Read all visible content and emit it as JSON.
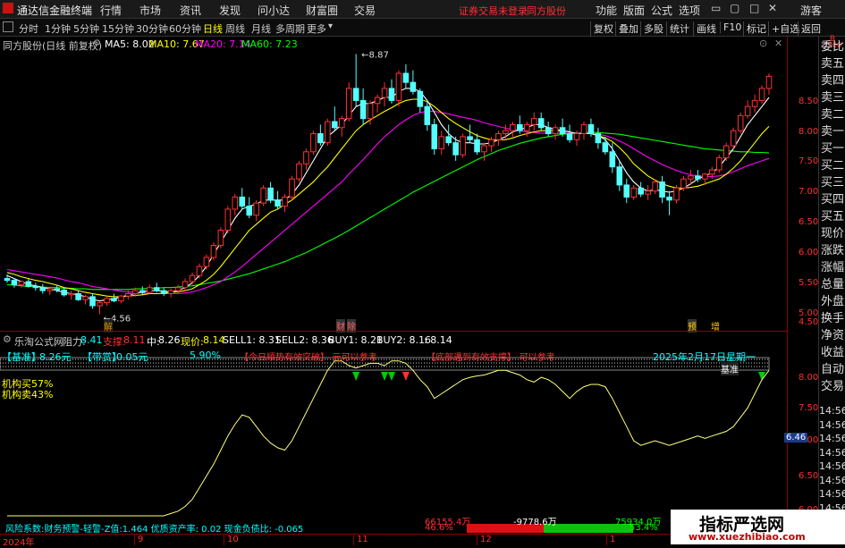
{
  "app_title": "通达信金融终端",
  "menus": [
    "行情",
    "市场",
    "资讯",
    "发现",
    "问小达",
    "财富圈",
    "交易"
  ],
  "login_status": "证券交易未登录",
  "broker": "同方股份",
  "top_right": [
    "功能",
    "版面",
    "公式",
    "选项"
  ],
  "guest": "游客",
  "timeframes": [
    "分时",
    "1分钟",
    "5分钟",
    "15分钟",
    "30分钟",
    "60分钟",
    "日线",
    "周线",
    "月线",
    "多周期",
    "更多"
  ],
  "active_timeframe": "日线",
  "toolbar_buttons": [
    "复权",
    "叠加",
    "多股",
    "统计",
    "画线",
    "F10",
    "标记",
    "+自选",
    "返回"
  ],
  "stock_info": "同方股份(日线 前复权)",
  "ma": {
    "ma5_label": "MA5: 8.02",
    "ma10_label": "MA10: 7.67",
    "ma20_label": "MA20: 7.14",
    "ma60_label": "MA60: 7.23",
    "ma5_color": "#ffffff",
    "ma10_color": "#ffff00",
    "ma20_color": "#ff00ff",
    "ma60_color": "#00ff00"
  },
  "price_axis": [
    "8.50",
    "8.00",
    "7.50",
    "7.00",
    "6.50",
    "6.00",
    "5.50",
    "5.00",
    "4.50"
  ],
  "price_annotations": {
    "high": "8.87",
    "low": "4.56"
  },
  "event_markers": [
    "解",
    "财",
    "除",
    "预",
    "增"
  ],
  "indicator": {
    "name": "乐淘公式网",
    "resistance_label": "阻力:",
    "resistance": "8.41",
    "support_label": "支撑:",
    "support": "8.11",
    "mid_label": "中:",
    "mid": "8.26",
    "price_label": "现价:",
    "price": "8.14",
    "sell1": "SELL1: 8.31",
    "sell2": "SELL2: 8.36",
    "buy1": "BUY1: 8.21",
    "buy2": "BUY2: 8.16",
    "last": ": 8.14",
    "baseline_tag": "【基准】",
    "baseline": "8.26元",
    "bear_tag": "【带赏】",
    "bear": "0.05元",
    "pct": "5.90%",
    "note1": "【今日顺势有效突破】-元可以参考",
    "note2": "【底部遇到有效支撑】-可以参考",
    "date": "2025年2月17日星期一",
    "baseline_marker": "基准",
    "inst_buy": "机构买57%",
    "inst_sell": "机构卖43%",
    "risk_text": "风险系数:财务预警-轻警-Z值:1.464 优质资产率: 0.02 现金负债比: -0.065",
    "sub_axis": [
      "8.00",
      "7.50",
      "7.00",
      "6.50",
      "6.00"
    ],
    "current_tag": "6.46"
  },
  "flow": {
    "left_amount": "66155.4万",
    "left_pct": "46.6%",
    "mid_amount": "-9778.6万",
    "right_amount": "75934.0万",
    "right_pct": "53.4%"
  },
  "date_axis": [
    "2024年",
    "9",
    "10",
    "11",
    "12",
    "1"
  ],
  "right_side_labels": [
    "委比",
    "卖五",
    "卖四",
    "卖三",
    "卖二",
    "卖一",
    "买一",
    "买二",
    "买三",
    "买四",
    "买五",
    "现价",
    "涨跌",
    "涨幅",
    "总量",
    "外盘",
    "换手",
    "净资",
    "收益",
    "自动",
    "交易"
  ],
  "time_labels": [
    "14:56",
    "14:56",
    "14:56",
    "14:56",
    "14:56",
    "14:56",
    "14:56",
    "14:56",
    "14:56",
    "14:56"
  ],
  "watermark": {
    "title": "指标严选网",
    "url": "www.xuezhibiao.com"
  },
  "chart_data": {
    "type": "candlestick",
    "title": "同方股份(日线 前复权)",
    "ylim": [
      4.3,
      8.95
    ],
    "candles": [
      [
        5.15,
        5.22,
        5.08,
        5.12
      ],
      [
        5.12,
        5.16,
        5.0,
        5.05
      ],
      [
        5.05,
        5.12,
        5.0,
        5.1
      ],
      [
        5.1,
        5.15,
        5.0,
        5.02
      ],
      [
        5.02,
        5.08,
        4.95,
        5.0
      ],
      [
        5.0,
        5.06,
        4.9,
        4.95
      ],
      [
        4.95,
        5.02,
        4.88,
        4.98
      ],
      [
        4.98,
        5.05,
        4.92,
        4.96
      ],
      [
        4.96,
        5.0,
        4.85,
        4.88
      ],
      [
        4.88,
        4.95,
        4.8,
        4.9
      ],
      [
        4.9,
        4.96,
        4.78,
        4.8
      ],
      [
        4.8,
        4.88,
        4.72,
        4.85
      ],
      [
        4.85,
        4.9,
        4.65,
        4.7
      ],
      [
        4.7,
        4.78,
        4.56,
        4.75
      ],
      [
        4.75,
        4.86,
        4.7,
        4.82
      ],
      [
        4.82,
        4.9,
        4.76,
        4.78
      ],
      [
        4.78,
        4.88,
        4.74,
        4.86
      ],
      [
        4.86,
        4.95,
        4.8,
        4.9
      ],
      [
        4.9,
        5.0,
        4.85,
        4.95
      ],
      [
        4.95,
        5.02,
        4.88,
        4.92
      ],
      [
        4.92,
        5.05,
        4.9,
        5.0
      ],
      [
        5.0,
        5.08,
        4.92,
        4.95
      ],
      [
        4.95,
        5.0,
        4.86,
        4.9
      ],
      [
        4.9,
        4.98,
        4.84,
        4.95
      ],
      [
        4.95,
        5.05,
        4.9,
        5.0
      ],
      [
        5.0,
        5.15,
        4.95,
        5.1
      ],
      [
        5.1,
        5.25,
        5.05,
        5.2
      ],
      [
        5.2,
        5.4,
        5.15,
        5.35
      ],
      [
        5.35,
        5.55,
        5.3,
        5.5
      ],
      [
        5.5,
        5.75,
        5.45,
        5.7
      ],
      [
        5.7,
        6.0,
        5.65,
        5.95
      ],
      [
        5.95,
        6.35,
        5.9,
        6.3
      ],
      [
        6.3,
        6.55,
        6.2,
        6.5
      ],
      [
        6.5,
        6.65,
        6.3,
        6.35
      ],
      [
        6.35,
        6.5,
        6.15,
        6.2
      ],
      [
        6.2,
        6.45,
        6.1,
        6.4
      ],
      [
        6.4,
        6.7,
        6.35,
        6.65
      ],
      [
        6.65,
        6.75,
        6.4,
        6.45
      ],
      [
        6.45,
        6.6,
        6.3,
        6.35
      ],
      [
        6.35,
        6.55,
        6.25,
        6.5
      ],
      [
        6.5,
        6.85,
        6.45,
        6.8
      ],
      [
        6.8,
        7.1,
        6.75,
        7.05
      ],
      [
        7.05,
        7.3,
        6.95,
        7.25
      ],
      [
        7.25,
        7.6,
        7.2,
        7.55
      ],
      [
        7.55,
        7.7,
        7.35,
        7.4
      ],
      [
        7.4,
        7.8,
        7.35,
        7.75
      ],
      [
        7.75,
        8.0,
        7.6,
        7.65
      ],
      [
        7.65,
        7.85,
        7.5,
        7.8
      ],
      [
        7.8,
        8.4,
        7.75,
        8.3
      ],
      [
        8.3,
        8.87,
        8.0,
        8.1
      ],
      [
        8.1,
        8.3,
        7.7,
        7.8
      ],
      [
        7.8,
        8.1,
        7.7,
        8.05
      ],
      [
        8.05,
        8.2,
        7.9,
        8.15
      ],
      [
        8.15,
        8.4,
        8.0,
        8.3
      ],
      [
        8.3,
        8.45,
        8.05,
        8.1
      ],
      [
        8.1,
        8.6,
        8.0,
        8.55
      ],
      [
        8.55,
        8.7,
        8.3,
        8.4
      ],
      [
        8.4,
        8.6,
        8.2,
        8.25
      ],
      [
        8.25,
        8.3,
        7.9,
        8.0
      ],
      [
        8.0,
        8.1,
        7.6,
        7.7
      ],
      [
        7.7,
        7.8,
        7.2,
        7.3
      ],
      [
        7.3,
        7.6,
        7.2,
        7.5
      ],
      [
        7.5,
        7.7,
        7.35,
        7.4
      ],
      [
        7.4,
        7.5,
        7.1,
        7.2
      ],
      [
        7.2,
        7.55,
        7.15,
        7.5
      ],
      [
        7.5,
        7.7,
        7.4,
        7.45
      ],
      [
        7.45,
        7.55,
        7.2,
        7.25
      ],
      [
        7.25,
        7.4,
        7.1,
        7.35
      ],
      [
        7.35,
        7.5,
        7.25,
        7.45
      ],
      [
        7.45,
        7.6,
        7.35,
        7.55
      ],
      [
        7.55,
        7.7,
        7.45,
        7.6
      ],
      [
        7.6,
        7.75,
        7.5,
        7.7
      ],
      [
        7.7,
        7.85,
        7.55,
        7.6
      ],
      [
        7.6,
        7.75,
        7.5,
        7.7
      ],
      [
        7.7,
        7.9,
        7.6,
        7.8
      ],
      [
        7.8,
        7.9,
        7.6,
        7.65
      ],
      [
        7.65,
        7.75,
        7.5,
        7.55
      ],
      [
        7.55,
        7.7,
        7.45,
        7.65
      ],
      [
        7.65,
        7.8,
        7.5,
        7.55
      ],
      [
        7.55,
        7.7,
        7.4,
        7.45
      ],
      [
        7.45,
        7.6,
        7.35,
        7.55
      ],
      [
        7.55,
        7.75,
        7.45,
        7.7
      ],
      [
        7.7,
        7.8,
        7.5,
        7.55
      ],
      [
        7.55,
        7.65,
        7.3,
        7.4
      ],
      [
        7.4,
        7.5,
        7.2,
        7.25
      ],
      [
        7.25,
        7.4,
        6.9,
        7.0
      ],
      [
        7.0,
        7.1,
        6.6,
        6.7
      ],
      [
        6.7,
        6.8,
        6.4,
        6.5
      ],
      [
        6.5,
        6.7,
        6.45,
        6.65
      ],
      [
        6.65,
        6.75,
        6.5,
        6.55
      ],
      [
        6.55,
        6.7,
        6.45,
        6.6
      ],
      [
        6.6,
        6.8,
        6.55,
        6.75
      ],
      [
        6.75,
        6.85,
        6.4,
        6.5
      ],
      [
        6.5,
        6.6,
        6.2,
        6.45
      ],
      [
        6.45,
        6.7,
        6.4,
        6.65
      ],
      [
        6.65,
        6.85,
        6.6,
        6.8
      ],
      [
        6.8,
        6.95,
        6.7,
        6.85
      ],
      [
        6.85,
        6.95,
        6.75,
        6.8
      ],
      [
        6.8,
        6.9,
        6.7,
        6.88
      ],
      [
        6.88,
        7.0,
        6.8,
        6.95
      ],
      [
        6.95,
        7.2,
        6.9,
        7.15
      ],
      [
        7.15,
        7.4,
        7.1,
        7.35
      ],
      [
        7.35,
        7.65,
        7.3,
        7.6
      ],
      [
        7.6,
        7.9,
        7.55,
        7.85
      ],
      [
        7.85,
        8.1,
        7.8,
        8.0
      ],
      [
        8.0,
        8.2,
        7.9,
        8.1
      ],
      [
        8.1,
        8.35,
        8.05,
        8.3
      ],
      [
        8.3,
        8.55,
        8.2,
        8.5
      ]
    ],
    "ma5": [
      5.2,
      5.15,
      5.1,
      5.05,
      5.03,
      5.0,
      4.98,
      4.95,
      4.92,
      4.9,
      4.88,
      4.85,
      4.8,
      4.78,
      4.8,
      4.82,
      4.84,
      4.88,
      4.9,
      4.93,
      4.95,
      4.95,
      4.94,
      4.93,
      4.95,
      5.0,
      5.08,
      5.2,
      5.35,
      5.55,
      5.75,
      5.95,
      6.15,
      6.3,
      6.35,
      6.38,
      6.45,
      6.45,
      6.45,
      6.45,
      6.55,
      6.7,
      6.9,
      7.1,
      7.3,
      7.5,
      7.6,
      7.7,
      7.85,
      8.0,
      8.05,
      8.05,
      8.1,
      8.15,
      8.15,
      8.25,
      8.3,
      8.3,
      8.25,
      8.1,
      7.9,
      7.7,
      7.55,
      7.45,
      7.4,
      7.4,
      7.38,
      7.38,
      7.4,
      7.45,
      7.5,
      7.58,
      7.62,
      7.65,
      7.7,
      7.7,
      7.65,
      7.62,
      7.6,
      7.58,
      7.55,
      7.55,
      7.55,
      7.52,
      7.45,
      7.3,
      7.1,
      6.9,
      6.75,
      6.65,
      6.6,
      6.62,
      6.6,
      6.58,
      6.6,
      6.65,
      6.72,
      6.8,
      6.85,
      6.9,
      7.0,
      7.15,
      7.3,
      7.5,
      7.7,
      7.85,
      8.0,
      8.15
    ],
    "ma10": [
      5.25,
      5.22,
      5.18,
      5.15,
      5.12,
      5.1,
      5.07,
      5.04,
      5.0,
      4.98,
      4.95,
      4.92,
      4.9,
      4.88,
      4.86,
      4.85,
      4.85,
      4.86,
      4.87,
      4.88,
      4.9,
      4.9,
      4.91,
      4.92,
      4.93,
      4.95,
      4.98,
      5.05,
      5.12,
      5.22,
      5.35,
      5.5,
      5.65,
      5.8,
      5.95,
      6.05,
      6.15,
      6.25,
      6.3,
      6.38,
      6.45,
      6.55,
      6.65,
      6.75,
      6.88,
      7.0,
      7.15,
      7.3,
      7.45,
      7.6,
      7.7,
      7.78,
      7.85,
      7.92,
      7.98,
      8.05,
      8.1,
      8.12,
      8.12,
      8.08,
      8.0,
      7.9,
      7.8,
      7.72,
      7.65,
      7.58,
      7.52,
      7.48,
      7.45,
      7.45,
      7.45,
      7.48,
      7.52,
      7.55,
      7.58,
      7.6,
      7.6,
      7.6,
      7.6,
      7.58,
      7.55,
      7.55,
      7.55,
      7.52,
      7.48,
      7.42,
      7.32,
      7.2,
      7.05,
      6.95,
      6.85,
      6.78,
      6.72,
      6.68,
      6.65,
      6.65,
      6.66,
      6.68,
      6.72,
      6.76,
      6.8,
      6.88,
      6.98,
      7.1,
      7.25,
      7.4,
      7.55,
      7.67
    ],
    "ma20": [
      5.3,
      5.28,
      5.26,
      5.24,
      5.22,
      5.2,
      5.18,
      5.16,
      5.13,
      5.1,
      5.08,
      5.05,
      5.02,
      5.0,
      4.98,
      4.96,
      4.94,
      4.93,
      4.92,
      4.91,
      4.9,
      4.9,
      4.9,
      4.9,
      4.9,
      4.91,
      4.93,
      4.96,
      5.0,
      5.05,
      5.1,
      5.18,
      5.26,
      5.35,
      5.45,
      5.55,
      5.65,
      5.75,
      5.85,
      5.95,
      6.05,
      6.15,
      6.25,
      6.35,
      6.45,
      6.55,
      6.65,
      6.75,
      6.88,
      7.0,
      7.12,
      7.25,
      7.38,
      7.5,
      7.6,
      7.7,
      7.78,
      7.85,
      7.9,
      7.92,
      7.92,
      7.9,
      7.88,
      7.85,
      7.82,
      7.8,
      7.77,
      7.73,
      7.7,
      7.67,
      7.64,
      7.62,
      7.6,
      7.58,
      7.57,
      7.56,
      7.56,
      7.56,
      7.56,
      7.56,
      7.56,
      7.56,
      7.55,
      7.54,
      7.52,
      7.48,
      7.43,
      7.37,
      7.3,
      7.23,
      7.16,
      7.1,
      7.04,
      6.99,
      6.94,
      6.9,
      6.87,
      6.85,
      6.84,
      6.84,
      6.85,
      6.88,
      6.92,
      6.97,
      7.02,
      7.06,
      7.1,
      7.14
    ],
    "ma60": [
      5.05,
      5.04,
      5.03,
      5.02,
      5.02,
      5.01,
      5.0,
      5.0,
      4.99,
      4.99,
      4.98,
      4.98,
      4.97,
      4.97,
      4.97,
      4.97,
      4.97,
      4.97,
      4.98,
      4.98,
      4.99,
      4.99,
      5.0,
      5.0,
      5.01,
      5.02,
      5.03,
      5.05,
      5.07,
      5.09,
      5.11,
      5.14,
      5.17,
      5.2,
      5.23,
      5.27,
      5.31,
      5.35,
      5.39,
      5.43,
      5.48,
      5.53,
      5.58,
      5.64,
      5.7,
      5.76,
      5.82,
      5.88,
      5.95,
      6.02,
      6.09,
      6.16,
      6.23,
      6.3,
      6.37,
      6.44,
      6.51,
      6.58,
      6.64,
      6.7,
      6.76,
      6.82,
      6.88,
      6.94,
      7.0,
      7.06,
      7.12,
      7.17,
      7.22,
      7.27,
      7.31,
      7.35,
      7.39,
      7.42,
      7.45,
      7.48,
      7.5,
      7.52,
      7.54,
      7.55,
      7.56,
      7.57,
      7.57,
      7.57,
      7.56,
      7.55,
      7.54,
      7.52,
      7.5,
      7.48,
      7.46,
      7.44,
      7.42,
      7.4,
      7.38,
      7.36,
      7.34,
      7.32,
      7.3,
      7.29,
      7.28,
      7.27,
      7.26,
      7.25,
      7.25,
      7.24,
      7.24,
      7.23
    ],
    "indicator_line": [
      5.0,
      5.0,
      5.0,
      5.0,
      5.0,
      5.0,
      5.0,
      5.0,
      5.0,
      5.0,
      5.0,
      5.0,
      5.0,
      5.0,
      5.0,
      5.0,
      5.0,
      5.0,
      5.0,
      5.0,
      5.0,
      5.0,
      5.0,
      5.05,
      5.1,
      5.2,
      5.35,
      5.6,
      5.85,
      6.1,
      6.4,
      6.7,
      6.95,
      7.15,
      7.1,
      6.9,
      6.7,
      6.55,
      6.45,
      6.4,
      6.6,
      6.9,
      7.2,
      7.5,
      7.8,
      8.1,
      8.3,
      8.3,
      8.2,
      8.15,
      8.2,
      8.25,
      8.25,
      8.2,
      8.3,
      8.3,
      8.25,
      8.1,
      7.9,
      7.75,
      7.5,
      7.6,
      7.7,
      7.8,
      7.9,
      7.95,
      7.98,
      8.0,
      8.05,
      8.1,
      8.1,
      8.05,
      8.0,
      7.9,
      7.85,
      7.95,
      7.9,
      7.8,
      7.65,
      7.5,
      7.65,
      7.75,
      7.8,
      7.8,
      7.75,
      7.5,
      7.2,
      6.9,
      6.6,
      6.5,
      6.55,
      6.6,
      6.55,
      6.5,
      6.55,
      6.6,
      6.65,
      6.7,
      6.65,
      6.7,
      6.75,
      6.8,
      6.9,
      7.1,
      7.3,
      7.6,
      7.9,
      8.1
    ]
  }
}
